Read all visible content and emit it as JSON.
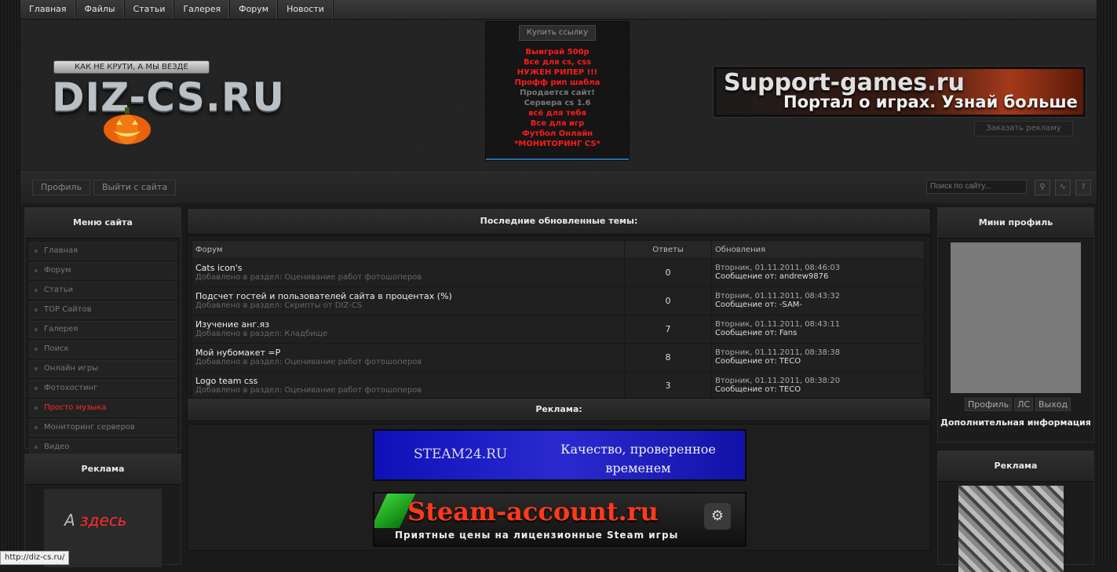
{
  "nav": {
    "items": [
      "Главная",
      "Файлы",
      "Статьи",
      "Галерея",
      "Форум",
      "Новости"
    ]
  },
  "header": {
    "slogan": "КАК НЕ КРУТИ, А МЫ ВЕЗДЕ",
    "logo_text": "DIZ-CS.RU",
    "buy_link": "Купить ссылку",
    "links": [
      {
        "text": "Выиграй 500р",
        "style": "red"
      },
      {
        "text": "Все для cs, css",
        "style": "red"
      },
      {
        "text": "НУЖЕН РИПЕР !!!",
        "style": "red"
      },
      {
        "text": "Профф рип шабла",
        "style": "red"
      },
      {
        "text": "Продается сайт!",
        "style": "gray"
      },
      {
        "text": "Сервера cs 1.6",
        "style": "gray"
      },
      {
        "text": "всё для тебя",
        "style": "red"
      },
      {
        "text": "Все для игр",
        "style": "red"
      },
      {
        "text": "Футбол Онлайн",
        "style": "red"
      },
      {
        "text": "*МОНИТОРИНГ CS*",
        "style": "red"
      }
    ],
    "banner_line1": "Support-games.ru",
    "banner_line2": "Портал о играх. Узнай больше",
    "order_ad": "Заказать рекламу"
  },
  "subbar": {
    "profile": "Профиль",
    "logout": "Выйти с сайта",
    "search_placeholder": "Поиск по сайту..."
  },
  "left_menu": {
    "title": "Меню сайта",
    "items": [
      {
        "label": "Главная"
      },
      {
        "label": "Форум"
      },
      {
        "label": "Статьи"
      },
      {
        "label": "TOP Сайтов"
      },
      {
        "label": "Галерея"
      },
      {
        "label": "Поиск"
      },
      {
        "label": "Онлайн игры"
      },
      {
        "label": "Фотохостинг"
      },
      {
        "label": "Просто музыка",
        "active": true
      },
      {
        "label": "Мониторинг серверов"
      },
      {
        "label": "Видео"
      }
    ]
  },
  "left_ad": {
    "title": "Реклама",
    "text_a": "А",
    "text_here": "здесь"
  },
  "main": {
    "title": "Последние обновленные темы:",
    "columns": [
      "Форум",
      "Ответы",
      "Обновления"
    ],
    "rows": [
      {
        "title": "Cats icon's",
        "section": "Добавлено в раздел: Оценивание работ фотошоперов",
        "replies": "0",
        "date": "Вторник, 01.11.2011, 08:46:03",
        "author": "Сообщение от: andrew9876"
      },
      {
        "title": "Подсчет гостей и пользователей сайта в процентах (%)",
        "section": "Добавлено в раздел: Скрипты от DIZ-CS",
        "replies": "0",
        "date": "Вторник, 01.11.2011, 08:43:32",
        "author": "Сообщение от: -SAM-"
      },
      {
        "title": "Изучение анг.яз",
        "section": "Добавлено в раздел: Кладбище",
        "replies": "7",
        "date": "Вторник, 01.11.2011, 08:43:11",
        "author": "Сообщение от: Fans"
      },
      {
        "title": "Мой нубомакет =P",
        "section": "Добавлено в раздел: Оценивание работ фотошоперов",
        "replies": "8",
        "date": "Вторник, 01.11.2011, 08:38:38",
        "author": "Сообщение от: TECO"
      },
      {
        "title": "Logo team css",
        "section": "Добавлено в раздел: Оценивание работ фотошоперов",
        "replies": "3",
        "date": "Вторник, 01.11.2011, 08:38:20",
        "author": "Сообщение от: TECO"
      }
    ],
    "ads_title": "Реклама:",
    "steam24_left": "STEAM24.RU",
    "steam24_right": "Качество, проверенное временем",
    "steamacc_title": "Steam-account.ru",
    "steamacc_sub": "Приятные цены на лицензионные Steam игры"
  },
  "right": {
    "profile_title": "Мини профиль",
    "buttons": [
      "Профиль",
      "ЛС",
      "Выход"
    ],
    "more": "Дополнительная информация",
    "ad_title": "Реклама"
  },
  "status": "http://diz-cs.ru/"
}
